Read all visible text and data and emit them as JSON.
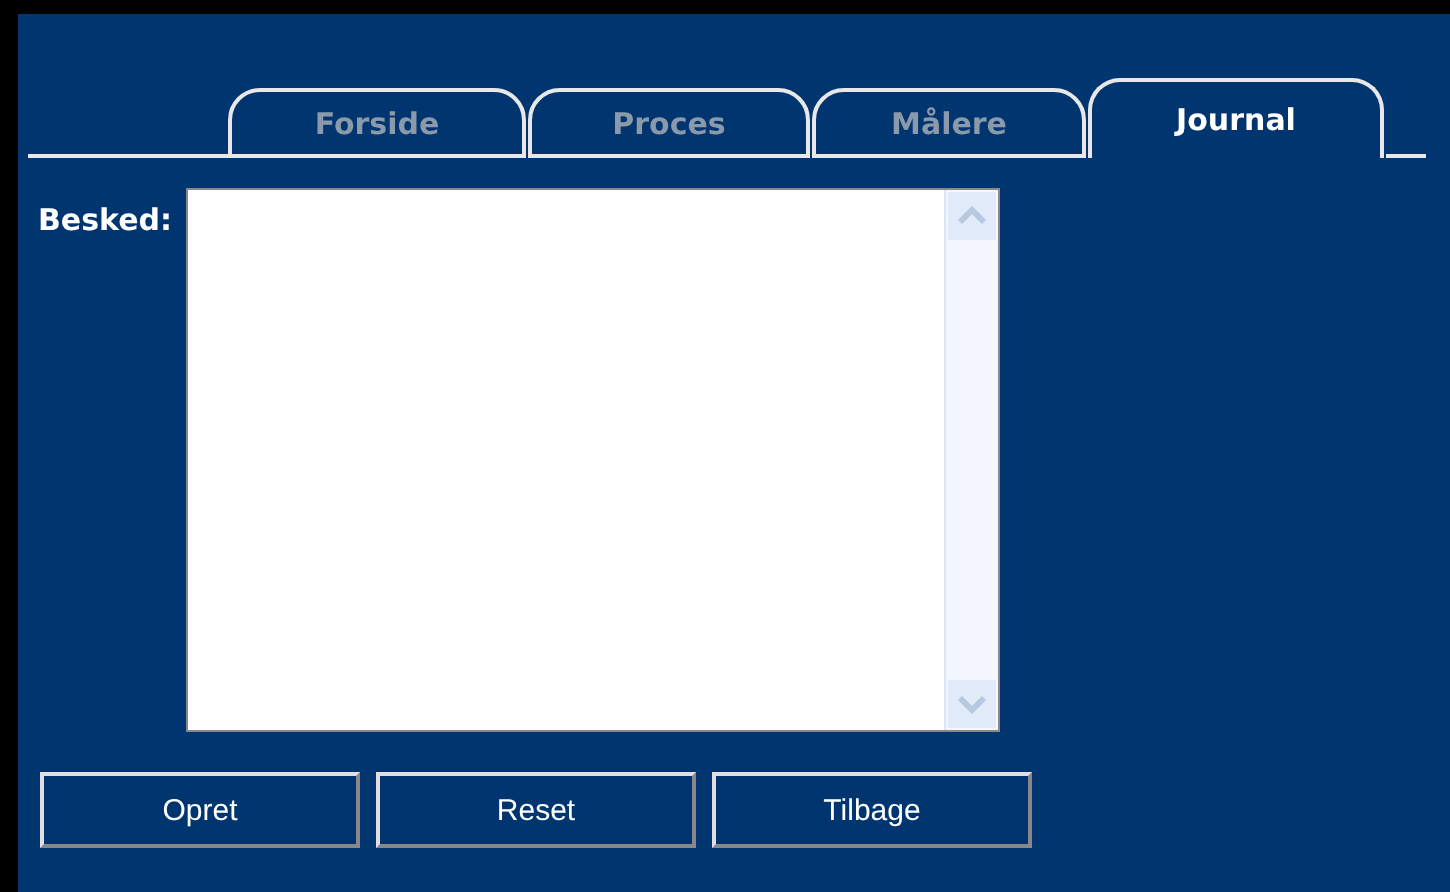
{
  "tabs": [
    {
      "label": "Forside",
      "selected": false
    },
    {
      "label": "Proces",
      "selected": false
    },
    {
      "label": "Målere",
      "selected": false
    },
    {
      "label": "Journal",
      "selected": true
    }
  ],
  "message": {
    "label": "Besked:"
  },
  "buttons": [
    "Opret",
    "Reset",
    "Tilbage"
  ]
}
